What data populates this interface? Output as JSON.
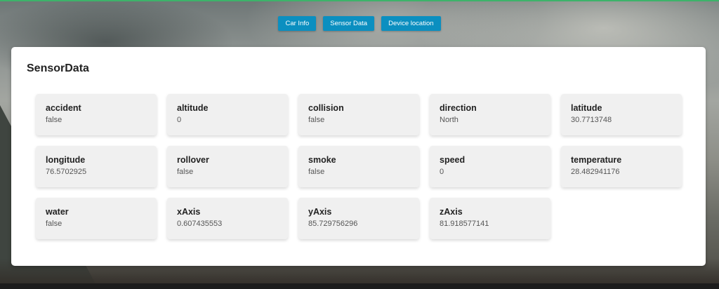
{
  "nav": {
    "buttons": [
      {
        "label": "Car Info"
      },
      {
        "label": "Sensor Data"
      },
      {
        "label": "Device location"
      }
    ]
  },
  "panel": {
    "title": "SensorData",
    "cards": [
      {
        "label": "accident",
        "value": "false"
      },
      {
        "label": "altitude",
        "value": "0"
      },
      {
        "label": "collision",
        "value": "false"
      },
      {
        "label": "direction",
        "value": "North"
      },
      {
        "label": "latitude",
        "value": "30.7713748"
      },
      {
        "label": "longitude",
        "value": "76.5702925"
      },
      {
        "label": "rollover",
        "value": "false"
      },
      {
        "label": "smoke",
        "value": "false"
      },
      {
        "label": "speed",
        "value": "0"
      },
      {
        "label": "temperature",
        "value": "28.482941176"
      },
      {
        "label": "water",
        "value": "false"
      },
      {
        "label": "xAxis",
        "value": "0.607435553"
      },
      {
        "label": "yAxis",
        "value": "85.729756296"
      },
      {
        "label": "zAxis",
        "value": "81.918577141"
      }
    ]
  },
  "colors": {
    "button": "#0b8fc0",
    "top_accent": "#3db36a"
  }
}
